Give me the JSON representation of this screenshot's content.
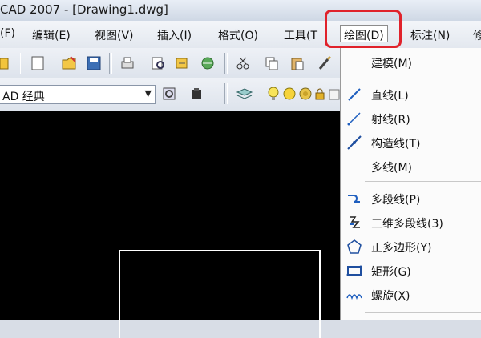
{
  "window": {
    "title": "CAD 2007 - [Drawing1.dwg]"
  },
  "menubar": {
    "items": [
      {
        "label": "(F)"
      },
      {
        "label": "编辑(E)"
      },
      {
        "label": "视图(V)"
      },
      {
        "label": "插入(I)"
      },
      {
        "label": "格式(O)"
      },
      {
        "label": "工具(T"
      },
      {
        "label": "绘图(D)",
        "active": true
      },
      {
        "label": "标注(N)"
      },
      {
        "label": "修"
      }
    ]
  },
  "toolbar2": {
    "workspace_value": "AD 经典"
  },
  "draw_menu": {
    "items": [
      {
        "label": "建模(M)",
        "icon": "none"
      },
      {
        "label": "直线(L)",
        "icon": "line-icon"
      },
      {
        "label": "射线(R)",
        "icon": "ray-icon"
      },
      {
        "label": "构造线(T)",
        "icon": "construction-line-icon"
      },
      {
        "label": "多线(M)",
        "icon": "none"
      },
      {
        "label": "多段线(P)",
        "icon": "polyline-icon"
      },
      {
        "label": "三维多段线(3)",
        "icon": "3d-polyline-icon"
      },
      {
        "label": "正多边形(Y)",
        "icon": "polygon-icon"
      },
      {
        "label": "矩形(G)",
        "icon": "rectangle-icon"
      },
      {
        "label": "螺旋(X)",
        "icon": "helix-icon"
      }
    ]
  },
  "colors": {
    "highlight": "#e0222b",
    "canvas": "#000000",
    "menu_bg": "#fbfbfb"
  }
}
